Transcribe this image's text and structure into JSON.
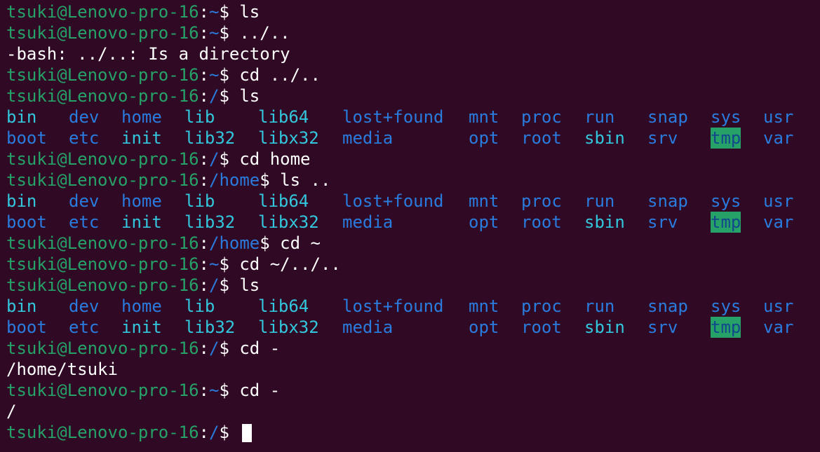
{
  "prompt": {
    "user_host": "tsuki@Lenovo-pro-16",
    "colon": ":",
    "dollar": "$"
  },
  "lines": [
    {
      "type": "prompt",
      "path": "~",
      "cmd": " ls"
    },
    {
      "type": "prompt",
      "path": "~",
      "cmd": " ../.."
    },
    {
      "type": "output",
      "text": "-bash: ../..: Is a directory"
    },
    {
      "type": "prompt",
      "path": "~",
      "cmd": " cd ../.."
    },
    {
      "type": "prompt",
      "path": "/",
      "cmd": " ls"
    },
    {
      "type": "ls1"
    },
    {
      "type": "ls2"
    },
    {
      "type": "prompt",
      "path": "/",
      "cmd": " cd home"
    },
    {
      "type": "prompt",
      "path": "/home",
      "cmd": " ls .."
    },
    {
      "type": "ls1"
    },
    {
      "type": "ls2"
    },
    {
      "type": "prompt",
      "path": "/home",
      "cmd": " cd ~"
    },
    {
      "type": "prompt",
      "path": "~",
      "cmd": " cd ~/../.."
    },
    {
      "type": "prompt",
      "path": "/",
      "cmd": " ls"
    },
    {
      "type": "ls1"
    },
    {
      "type": "ls2"
    },
    {
      "type": "prompt",
      "path": "/",
      "cmd": " cd -"
    },
    {
      "type": "output",
      "text": "/home/tsuki"
    },
    {
      "type": "prompt",
      "path": "~",
      "cmd": " cd -"
    },
    {
      "type": "output",
      "text": "/"
    },
    {
      "type": "prompt",
      "path": "/",
      "cmd": " ",
      "cursor": true
    }
  ],
  "ls_row1": [
    "bin",
    "dev",
    "home",
    "lib",
    "lib64",
    "lost+found",
    "mnt",
    "proc",
    "run",
    "snap",
    "sys",
    "usr"
  ],
  "ls_row2": [
    "boot",
    "etc",
    "init",
    "lib32",
    "libx32",
    "media",
    "opt",
    "root",
    "sbin",
    "srv",
    "tmp",
    "var"
  ],
  "ls_styles_row1": [
    "link",
    "dir",
    "dir",
    "link",
    "link",
    "dir",
    "dir",
    "dir",
    "dir",
    "dir",
    "dir",
    "dir"
  ],
  "ls_styles_row2": [
    "dir",
    "dir",
    "exe-dir",
    "link",
    "link",
    "dir",
    "dir",
    "dir",
    "link",
    "dir",
    "green-bg",
    "dir"
  ],
  "colors": {
    "background": "#300a24",
    "prompt_user": "#26a269",
    "prompt_path": "#2a7bde",
    "directory": "#2a7bde",
    "symlink": "#33c7de",
    "sticky_dir_bg": "#26a269"
  }
}
